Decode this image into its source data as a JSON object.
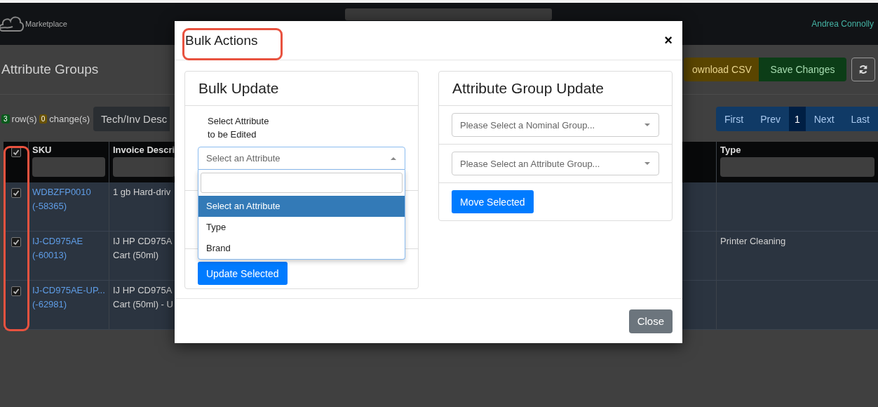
{
  "navbar": {
    "brand": "Marketplace",
    "user": "Andrea Connolly"
  },
  "page": {
    "title": "Attribute Groups",
    "actions": [
      {
        "label": "ownload CSV",
        "kind": "warning"
      },
      {
        "label": "Save Changes",
        "kind": "success"
      }
    ]
  },
  "toolbar": {
    "rows_count": "3",
    "rows_label": "row(s)",
    "changes_count": "0",
    "changes_label": "change(s)",
    "filter_button": "Tech/Inv Desc"
  },
  "pagination": [
    {
      "label": "First",
      "selected": false
    },
    {
      "label": "Prev",
      "selected": false
    },
    {
      "label": "1",
      "selected": true
    },
    {
      "label": "Next",
      "selected": false
    },
    {
      "label": "Last",
      "selected": false
    }
  ],
  "table": {
    "select_all_checked": true,
    "columns": [
      "SKU",
      "Invoice Descri",
      "Type"
    ],
    "rows": [
      {
        "checked": true,
        "sku": "WDBZFP0010",
        "sku_id": "(-58365)",
        "description": [
          "1 gb Hard-driv"
        ]
      },
      {
        "checked": true,
        "sku": "IJ-CD975AE",
        "sku_id": "(-60013)",
        "description": [
          "IJ HP CD975A",
          "Cart (50ml)"
        ],
        "type": "Printer Cleaning"
      },
      {
        "checked": true,
        "sku": "IJ-CD975AE-UP...",
        "sku_id": "(-62981)",
        "description": [
          "IJ HP CD975A",
          "Cart (50ml) - U"
        ]
      }
    ]
  },
  "modal": {
    "title": "Bulk Actions",
    "close": "×",
    "bulk_update": {
      "title": "Bulk Update",
      "label": "Select Attribute to be Edited",
      "select": {
        "value": "Select an Attribute",
        "open": true,
        "options": [
          {
            "label": "Select an Attribute",
            "selected": true
          },
          {
            "label": "Type",
            "selected": false
          },
          {
            "label": "Brand",
            "selected": false
          }
        ]
      },
      "button": "Update Selected"
    },
    "group_update": {
      "title": "Attribute Group Update",
      "selects": [
        {
          "placeholder": "Please Select a Nominal Group...",
          "open": false
        },
        {
          "placeholder": "Please Select an Attribute Group...",
          "open": false
        }
      ],
      "button": "Move Selected"
    },
    "footer_button": "Close"
  }
}
